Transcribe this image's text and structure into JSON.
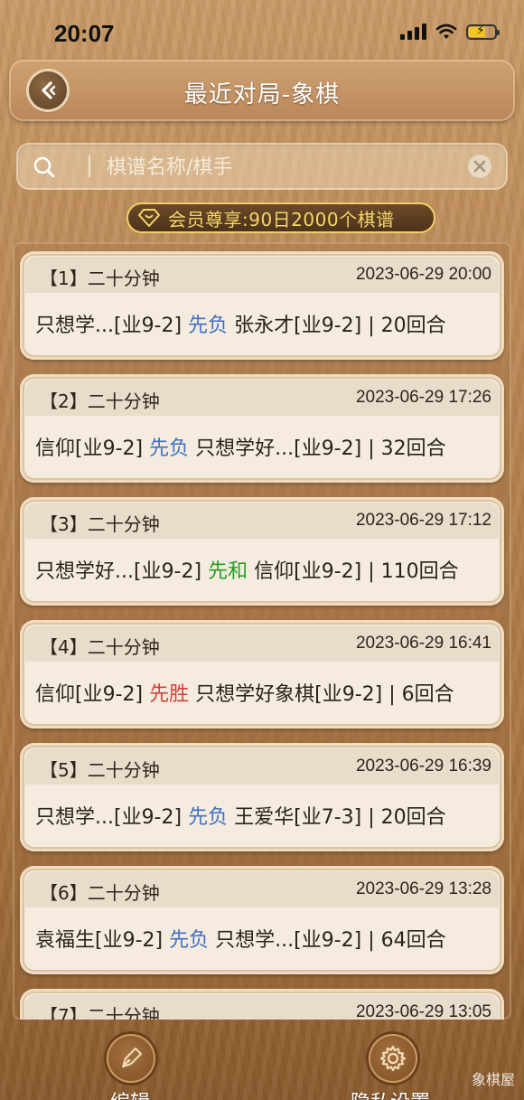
{
  "status_bar": {
    "time": "20:07"
  },
  "header": {
    "title": "最近对局-象棋"
  },
  "search": {
    "placeholder": "棋谱名称/棋手",
    "value": ""
  },
  "vip_banner": {
    "text": "会员尊享:90日2000个棋谱"
  },
  "games": [
    {
      "index": "【1】",
      "mode": "二十分钟",
      "datetime": "2023-06-29 20:00",
      "player_a": "只想学...[业9-2]",
      "result": "先负",
      "result_color": "blue",
      "player_b": "张永才[业9-2]",
      "moves": "| 20回合"
    },
    {
      "index": "【2】",
      "mode": "二十分钟",
      "datetime": "2023-06-29 17:26",
      "player_a": "信仰[业9-2]",
      "result": "先负",
      "result_color": "blue",
      "player_b": "只想学好...[业9-2]",
      "moves": "| 32回合"
    },
    {
      "index": "【3】",
      "mode": "二十分钟",
      "datetime": "2023-06-29 17:12",
      "player_a": "只想学好...[业9-2]",
      "result": "先和",
      "result_color": "green",
      "player_b": "信仰[业9-2]",
      "moves": "| 110回合"
    },
    {
      "index": "【4】",
      "mode": "二十分钟",
      "datetime": "2023-06-29 16:41",
      "player_a": "信仰[业9-2]",
      "result": "先胜",
      "result_color": "red",
      "player_b": "只想学好象棋[业9-2]",
      "moves": "| 6回合"
    },
    {
      "index": "【5】",
      "mode": "二十分钟",
      "datetime": "2023-06-29 16:39",
      "player_a": "只想学...[业9-2]",
      "result": "先负",
      "result_color": "blue",
      "player_b": "王爱华[业7-3]",
      "moves": "| 20回合"
    },
    {
      "index": "【6】",
      "mode": "二十分钟",
      "datetime": "2023-06-29 13:28",
      "player_a": "袁福生[业9-2]",
      "result": "先负",
      "result_color": "blue",
      "player_b": "只想学...[业9-2]",
      "moves": "| 64回合"
    },
    {
      "index": "【7】",
      "mode": "二十分钟",
      "datetime": "2023-06-29 13:05",
      "player_a": "",
      "result": "",
      "result_color": "blue",
      "player_b": "",
      "moves": ""
    }
  ],
  "bottom_nav": {
    "edit_label": "编辑",
    "privacy_label": "隐私设置"
  },
  "watermark": "象棋屋",
  "colors": {
    "result_blue": "#3f6fc2",
    "result_green": "#23a023",
    "result_red": "#d2403b",
    "vip_gold": "#f6d56b"
  }
}
